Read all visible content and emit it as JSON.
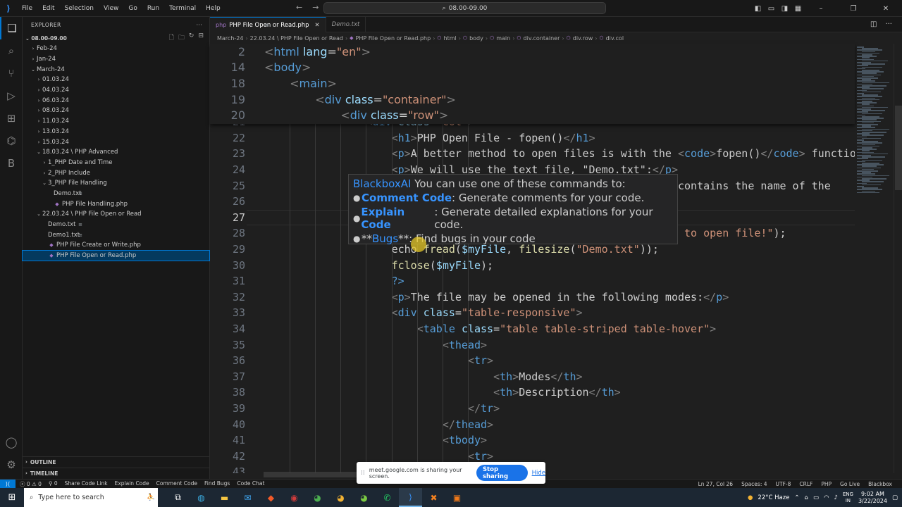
{
  "titlebar": {
    "menu": [
      "File",
      "Edit",
      "Selection",
      "View",
      "Go",
      "Run",
      "Terminal",
      "Help"
    ],
    "search": "08.00-09.00"
  },
  "sidebar": {
    "header": "EXPLORER",
    "root": "08.00-09.00",
    "tree": [
      {
        "label": "Feb-24",
        "indent": 1,
        "chev": "›",
        "icon": ""
      },
      {
        "label": "Jan-24",
        "indent": 1,
        "chev": "›",
        "icon": ""
      },
      {
        "label": "March-24",
        "indent": 1,
        "chev": "⌄",
        "icon": ""
      },
      {
        "label": "01.03.24",
        "indent": 2,
        "chev": "›",
        "icon": ""
      },
      {
        "label": "04.03.24",
        "indent": 2,
        "chev": "›",
        "icon": ""
      },
      {
        "label": "06.03.24",
        "indent": 2,
        "chev": "›",
        "icon": ""
      },
      {
        "label": "08.03.24",
        "indent": 2,
        "chev": "›",
        "icon": ""
      },
      {
        "label": "11.03.24",
        "indent": 2,
        "chev": "›",
        "icon": ""
      },
      {
        "label": "13.03.24",
        "indent": 2,
        "chev": "›",
        "icon": ""
      },
      {
        "label": "15.03.24",
        "indent": 2,
        "chev": "›",
        "icon": ""
      },
      {
        "label": "18.03.24 \\ PHP Advanced",
        "indent": 2,
        "chev": "⌄",
        "icon": ""
      },
      {
        "label": "1_PHP Date and Time",
        "indent": 3,
        "chev": "›",
        "icon": ""
      },
      {
        "label": "2_PHP Include",
        "indent": 3,
        "chev": "›",
        "icon": ""
      },
      {
        "label": "3_PHP File Handling",
        "indent": 3,
        "chev": "⌄",
        "icon": ""
      },
      {
        "label": "Demo.txt",
        "indent": 4,
        "chev": "",
        "icon": "txt"
      },
      {
        "label": "PHP File Handling.php",
        "indent": 4,
        "chev": "",
        "icon": "php"
      },
      {
        "label": "22.03.24 \\ PHP File Open or Read",
        "indent": 2,
        "chev": "⌄",
        "icon": ""
      },
      {
        "label": "Demo.txt",
        "indent": 3,
        "chev": "",
        "icon": "txt"
      },
      {
        "label": "Demo1.txt",
        "indent": 3,
        "chev": "",
        "icon": "txt"
      },
      {
        "label": "PHP File Create or Write.php",
        "indent": 3,
        "chev": "",
        "icon": "php"
      },
      {
        "label": "PHP File Open or Read.php",
        "indent": 3,
        "chev": "",
        "icon": "php",
        "selected": true
      }
    ],
    "outline": "OUTLINE",
    "timeline": "TIMELINE"
  },
  "tabs": [
    {
      "label": "PHP File Open or Read.php",
      "active": true
    },
    {
      "label": "Demo.txt",
      "active": false
    }
  ],
  "breadcrumbs": [
    "March-24",
    "22.03.24 \\ PHP File Open or Read",
    "PHP File Open or Read.php",
    "html",
    "body",
    "main",
    "div.container",
    "div.row",
    "div.col"
  ],
  "code": {
    "sticky": [
      {
        "n": "2",
        "indent": 0,
        "html": "<span class=\"br\">&lt;</span><span class=\"tg\">html</span> <span class=\"at\">lang</span>=<span class=\"st\">\"en\"</span><span class=\"br\">&gt;</span>"
      },
      {
        "n": "14",
        "indent": 0,
        "html": "<span class=\"br\">&lt;</span><span class=\"tg\">body</span><span class=\"br\">&gt;</span>"
      },
      {
        "n": "18",
        "indent": 1,
        "html": "<span class=\"br\">&lt;</span><span class=\"tg\">main</span><span class=\"br\">&gt;</span>"
      },
      {
        "n": "19",
        "indent": 2,
        "html": "<span class=\"br\">&lt;</span><span class=\"tg\">div</span> <span class=\"at\">class</span>=<span class=\"st\">\"container\"</span><span class=\"br\">&gt;</span>"
      },
      {
        "n": "20",
        "indent": 3,
        "html": "<span class=\"br\">&lt;</span><span class=\"tg\">div</span> <span class=\"at\">class</span>=<span class=\"st\">\"row\"</span><span class=\"br\">&gt;</span>"
      }
    ],
    "lines": [
      {
        "n": "21",
        "indent": 4,
        "html": "<span class=\"br\">&lt;</span><span class=\"tg\">div</span> <span class=\"at\">class</span>=<span class=\"st\">\"col\"</span><span class=\"br\">&gt;</span>"
      },
      {
        "n": "22",
        "indent": 5,
        "html": "<span class=\"br\">&lt;</span><span class=\"tg\">h1</span><span class=\"br\">&gt;</span>PHP Open File - fopen()<span class=\"br\">&lt;/</span><span class=\"tg\">h1</span><span class=\"br\">&gt;</span>"
      },
      {
        "n": "23",
        "indent": 5,
        "html": "<span class=\"br\">&lt;</span><span class=\"tg\">p</span><span class=\"br\">&gt;</span>A better method to open files is with the <span class=\"br\">&lt;</span><span class=\"tg\">code</span><span class=\"br\">&gt;</span>fopen()<span class=\"br\">&lt;/</span><span class=\"tg\">code</span><span class=\"br\">&gt;</span> function"
      },
      {
        "n": "24",
        "indent": 5,
        "html": "<span class=\"br\">&lt;</span><span class=\"tg\">p</span><span class=\"br\">&gt;</span>We will use the text file, \"Demo.txt\":<span class=\"br\">&lt;/</span><span class=\"tg\">p</span><span class=\"br\">&gt;</span>"
      },
      {
        "n": "25",
        "indent": 5,
        "html": "                                          <span class=\"br\">e&gt;</span> contains the name of the"
      },
      {
        "n": "26",
        "indent": 5,
        "html": ""
      },
      {
        "n": "27",
        "indent": 5,
        "html": "",
        "current": true
      },
      {
        "n": "28",
        "indent": 5,
        "html": "                                          <span class=\"st\">ble to open file!\"</span>);"
      },
      {
        "n": "29",
        "indent": 5,
        "html": "<span class=\"pl\">echo</span> <span class=\"fn\">fread</span>(<span class=\"vr\">$myFile</span>, <span class=\"fn\">filesize</span>(<span class=\"st\">\"Demo.txt\"</span>));"
      },
      {
        "n": "30",
        "indent": 5,
        "html": "<span class=\"fn\">fclose</span>(<span class=\"vr\">$myFile</span>);"
      },
      {
        "n": "31",
        "indent": 5,
        "html": "<span class=\"pp\">?&gt;</span>"
      },
      {
        "n": "32",
        "indent": 5,
        "html": "<span class=\"br\">&lt;</span><span class=\"tg\">p</span><span class=\"br\">&gt;</span>The file may be opened in the following modes:<span class=\"br\">&lt;/</span><span class=\"tg\">p</span><span class=\"br\">&gt;</span>"
      },
      {
        "n": "33",
        "indent": 5,
        "html": "<span class=\"br\">&lt;</span><span class=\"tg\">div</span> <span class=\"at\">class</span>=<span class=\"st\">\"table-responsive\"</span><span class=\"br\">&gt;</span>"
      },
      {
        "n": "34",
        "indent": 6,
        "html": "<span class=\"br\">&lt;</span><span class=\"tg\">table</span> <span class=\"at\">class</span>=<span class=\"st\">\"table table-striped table-hover\"</span><span class=\"br\">&gt;</span>"
      },
      {
        "n": "35",
        "indent": 7,
        "html": "<span class=\"br\">&lt;</span><span class=\"tg\">thead</span><span class=\"br\">&gt;</span>"
      },
      {
        "n": "36",
        "indent": 8,
        "html": "<span class=\"br\">&lt;</span><span class=\"tg\">tr</span><span class=\"br\">&gt;</span>"
      },
      {
        "n": "37",
        "indent": 9,
        "html": "<span class=\"br\">&lt;</span><span class=\"tg\">th</span><span class=\"br\">&gt;</span>Modes<span class=\"br\">&lt;/</span><span class=\"tg\">th</span><span class=\"br\">&gt;</span>"
      },
      {
        "n": "38",
        "indent": 9,
        "html": "<span class=\"br\">&lt;</span><span class=\"tg\">th</span><span class=\"br\">&gt;</span>Description<span class=\"br\">&lt;/</span><span class=\"tg\">th</span><span class=\"br\">&gt;</span>"
      },
      {
        "n": "39",
        "indent": 8,
        "html": "<span class=\"br\">&lt;/</span><span class=\"tg\">tr</span><span class=\"br\">&gt;</span>"
      },
      {
        "n": "40",
        "indent": 7,
        "html": "<span class=\"br\">&lt;/</span><span class=\"tg\">thead</span><span class=\"br\">&gt;</span>"
      },
      {
        "n": "41",
        "indent": 7,
        "html": "<span class=\"br\">&lt;</span><span class=\"tg\">tbody</span><span class=\"br\">&gt;</span>"
      },
      {
        "n": "42",
        "indent": 8,
        "html": "<span class=\"br\">&lt;</span><span class=\"tg\">tr</span><span class=\"br\">&gt;</span>"
      },
      {
        "n": "43",
        "indent": 9,
        "html": ""
      }
    ]
  },
  "popup": {
    "title_link": "BlackboxAI",
    "title_text": " You can use one of these commands to:",
    "items": [
      {
        "link": "Comment Code",
        "text": ": Generate comments for your code."
      },
      {
        "link": "Explain Code",
        "text": ": Generate detailed explanations for your code."
      },
      {
        "prefix": "**",
        "link": "Bugs",
        "text": " **: Find bugs in your code"
      }
    ]
  },
  "share_banner": {
    "text": "meet.google.com is sharing your screen.",
    "stop": "Stop sharing",
    "hide": "Hide"
  },
  "statusbar": {
    "errors": "0",
    "warnings": "0",
    "ports": "0",
    "left_items": [
      "Share Code Link",
      "Explain Code",
      "Comment Code",
      "Find Bugs",
      "Code Chat"
    ],
    "right_items": [
      "Ln 27, Col 26",
      "Spaces: 4",
      "UTF-8",
      "CRLF",
      "PHP",
      "Go Live",
      "Blackbox"
    ]
  },
  "taskbar": {
    "search_placeholder": "Type here to search",
    "weather": "22°C  Haze",
    "lang1": "ENG",
    "lang2": "IN",
    "time": "9:02 AM",
    "date": "3/22/2024"
  }
}
